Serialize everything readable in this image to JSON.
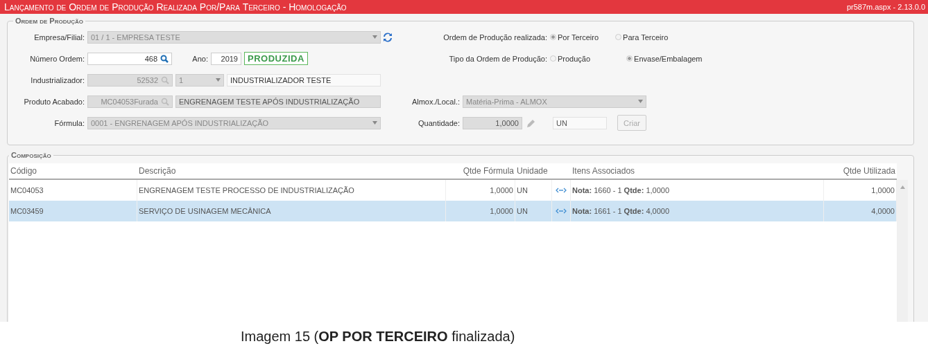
{
  "title": "Lançamento de Ordem de Produção Realizada Por/Para Terceiro  - Homologação",
  "version": "pr587m.aspx - 2.13.0.0",
  "ordem": {
    "legend": "Ordem de Produção",
    "empresa": {
      "label": "Empresa/Filial:",
      "value": "01 / 1 - EMPRESA TESTE",
      "disabled": true
    },
    "realizada": {
      "label": "Ordem de Produção realizada:",
      "options": [
        {
          "label": "Por Terceiro",
          "selected": true
        },
        {
          "label": "Para Terceiro",
          "selected": false
        }
      ]
    },
    "numero": {
      "label": "Número Ordem:",
      "value": "468",
      "disabled": false
    },
    "ano": {
      "label": "Ano:",
      "value": "2019",
      "disabled": false
    },
    "status": "PRODUZIDA",
    "tipo": {
      "label": "Tipo da Ordem de Produção:",
      "options": [
        {
          "label": "Produção",
          "selected": false
        },
        {
          "label": "Envase/Embalagem",
          "selected": true
        }
      ]
    },
    "industrializador": {
      "label": "Industrializador:",
      "code": "52532",
      "seq": "1",
      "name": "INDUSTRIALIZADOR TESTE",
      "disabled": true
    },
    "produto": {
      "label": "Produto Acabado:",
      "code": "MC04053Furada",
      "name": "ENGRENAGEM TESTE APÓS INDUSTRIALIZAÇÃO",
      "disabled": true
    },
    "almox": {
      "label": "Almox./Local.:",
      "value": "Matéria-Prima - ALMOX",
      "disabled": true
    },
    "formula": {
      "label": "Fórmula:",
      "value": "0001 - ENGRENAGEM APÓS INDUSTRIALIZAÇÃO",
      "disabled": true
    },
    "quantidade": {
      "label": "Quantidade:",
      "value": "1,0000",
      "unit": "UN",
      "disabled": true
    },
    "criar": {
      "label": "Criar",
      "disabled": true
    }
  },
  "composicao": {
    "legend": "Composição",
    "columns": [
      "Código",
      "Descrição",
      "Qtde Fórmula",
      "Unidade",
      "Itens Associados",
      "Qtde Utilizada"
    ],
    "rows": [
      {
        "codigo": "MC04053",
        "descricao": "ENGRENAGEM TESTE PROCESSO DE INDUSTRIALIZAÇÃO",
        "qtde_formula": "1,0000",
        "unidade": "UN",
        "itens": "**Nota:** 1660 - 1 **Qtde:** 1,0000",
        "qtde_utilizada": "1,0000",
        "selected": false
      },
      {
        "codigo": "MC03459",
        "descricao": "SERVIÇO DE USINAGEM MECÂNICA",
        "qtde_formula": "1,0000",
        "unidade": "UN",
        "itens": "**Nota:** 1661 - 1 **Qtde:** 4,0000",
        "qtde_utilizada": "4,0000",
        "selected": true
      }
    ]
  },
  "caption": "Imagem 15 (**OP POR TERCEIRO** finalizada)"
}
